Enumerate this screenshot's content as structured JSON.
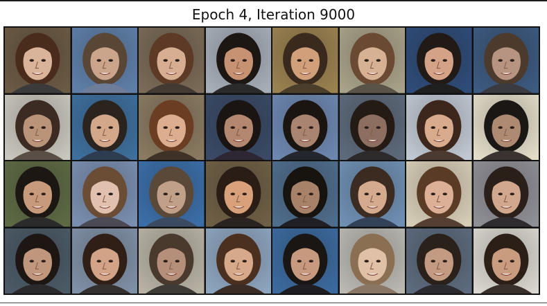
{
  "figure": {
    "title": "Epoch 4, Iteration 9000"
  },
  "image_grid": {
    "rows": 4,
    "cols": 8,
    "content": "generated face samples",
    "tiles": [
      {
        "bg": "#6b5a44",
        "hair": "#4a2c1c",
        "skin": "#d9b49a",
        "shirt": "#3b3b3b"
      },
      {
        "bg": "#5f7fa8",
        "hair": "#5a4634",
        "skin": "#caa58b",
        "shirt": "#6e7e9a"
      },
      {
        "bg": "#7a6a56",
        "hair": "#5c3a26",
        "skin": "#d7ae92",
        "shirt": "#433a33"
      },
      {
        "bg": "#a6aeb8",
        "hair": "#1d1713",
        "skin": "#c79274",
        "shirt": "#2a2a2a"
      },
      {
        "bg": "#9a8150",
        "hair": "#3a2a1e",
        "skin": "#d1a07a",
        "shirt": "#4b3f2c"
      },
      {
        "bg": "#a9a289",
        "hair": "#6a4a32",
        "skin": "#d6b193",
        "shirt": "#5a5448"
      },
      {
        "bg": "#2f4c78",
        "hair": "#221a16",
        "skin": "#d4a286",
        "shirt": "#1f1f1f"
      },
      {
        "bg": "#3d5a80",
        "hair": "#4c3a2c",
        "skin": "#b79481",
        "shirt": "#3a3b40"
      },
      {
        "bg": "#c9c6bd",
        "hair": "#3b2b22",
        "skin": "#b99479",
        "shirt": "#5a4f45"
      },
      {
        "bg": "#3e6f9d",
        "hair": "#2b231d",
        "skin": "#d3a88a",
        "shirt": "#2e3c52"
      },
      {
        "bg": "#8a7a61",
        "hair": "#6b3e24",
        "skin": "#dcae8f",
        "shirt": "#403226"
      },
      {
        "bg": "#3a4a66",
        "hair": "#1a1412",
        "skin": "#b38770",
        "shirt": "#2d2633"
      },
      {
        "bg": "#6e87b0",
        "hair": "#1b1512",
        "skin": "#a98471",
        "shirt": "#24262e"
      },
      {
        "bg": "#5d6a7a",
        "hair": "#241b15",
        "skin": "#8c6f60",
        "shirt": "#2c2a2a"
      },
      {
        "bg": "#c0c8d2",
        "hair": "#3d271c",
        "skin": "#d8ab8c",
        "shirt": "#4b3a30"
      },
      {
        "bg": "#e2dcc8",
        "hair": "#1b1714",
        "skin": "#ae8a72",
        "shirt": "#3a3330"
      },
      {
        "bg": "#5d6a44",
        "hair": "#1d1714",
        "skin": "#c89a7c",
        "shirt": "#2b2b2b"
      },
      {
        "bg": "#7a8fb0",
        "hair": "#6b4c34",
        "skin": "#e2c0b0",
        "shirt": "#4b4a55"
      },
      {
        "bg": "#3b6ea8",
        "hair": "#5a4838",
        "skin": "#c1a089",
        "shirt": "#3c4a62"
      },
      {
        "bg": "#6f5f45",
        "hair": "#2a1d16",
        "skin": "#d8a17c",
        "shirt": "#2b2320"
      },
      {
        "bg": "#4f6d8c",
        "hair": "#17130f",
        "skin": "#a88169",
        "shirt": "#1f1f24"
      },
      {
        "bg": "#6f8fb3",
        "hair": "#3b2b20",
        "skin": "#d5ab8f",
        "shirt": "#344257"
      },
      {
        "bg": "#d6cdb6",
        "hair": "#5a3b25",
        "skin": "#dcb096",
        "shirt": "#553f32"
      },
      {
        "bg": "#8f8f96",
        "hair": "#2a2019",
        "skin": "#d1a88d",
        "shirt": "#2e2c2e"
      },
      {
        "bg": "#4b5a66",
        "hair": "#1d1613",
        "skin": "#c0967c",
        "shirt": "#2a2a2c"
      },
      {
        "bg": "#8090a6",
        "hair": "#2f1f16",
        "skin": "#d2a386",
        "shirt": "#33302f"
      },
      {
        "bg": "#b8b2a5",
        "hair": "#4a3a2d",
        "skin": "#b58f79",
        "shirt": "#3e3a36"
      },
      {
        "bg": "#8ea5bf",
        "hair": "#4b2f1f",
        "skin": "#d7a98b",
        "shirt": "#3b2d25"
      },
      {
        "bg": "#3c6a9e",
        "hair": "#1a1613",
        "skin": "#c79a80",
        "shirt": "#1d1d22"
      },
      {
        "bg": "#b9b8b1",
        "hair": "#8b6f52",
        "skin": "#e0c0a7",
        "shirt": "#8a7665"
      },
      {
        "bg": "#5c6b7d",
        "hair": "#2a211b",
        "skin": "#c39a82",
        "shirt": "#2b2a2f"
      },
      {
        "bg": "#d9d6cf",
        "hair": "#2b1f18",
        "skin": "#c99c80",
        "shirt": "#3a302b"
      }
    ]
  }
}
